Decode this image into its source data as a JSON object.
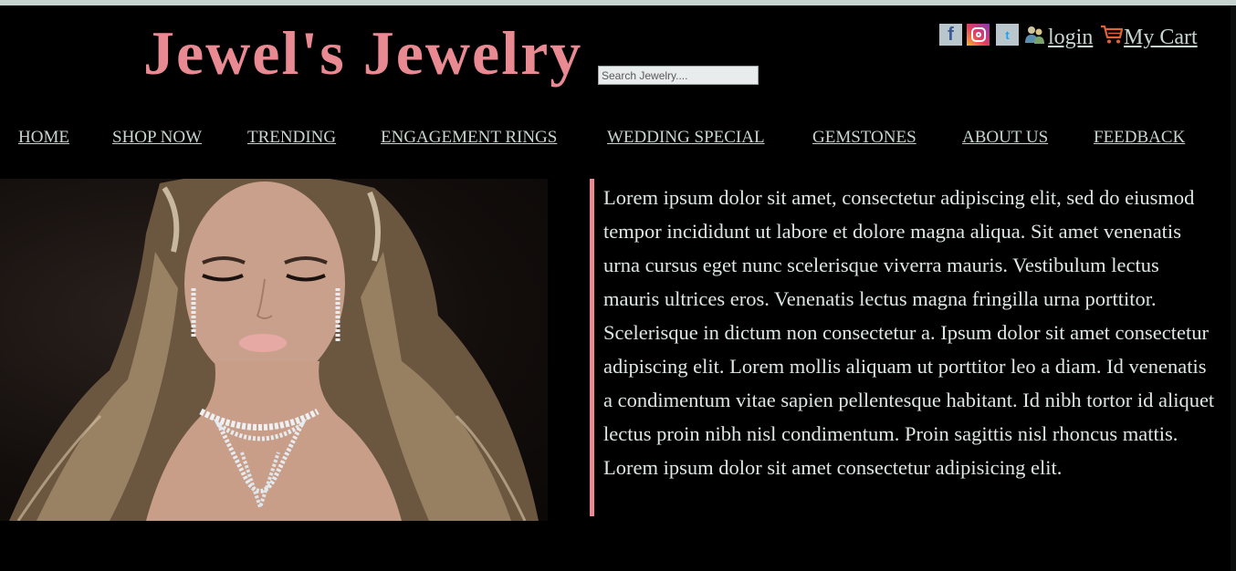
{
  "header": {
    "brand_title": "Jewel's Jewelry",
    "search_placeholder": "Search Jewelry....",
    "social": {
      "facebook_glyph": "f",
      "twitter_glyph": "t",
      "icons": [
        "facebook-icon",
        "instagram-icon",
        "twitter-icon"
      ]
    },
    "login_label": "login",
    "cart_label": "My Cart",
    "accent_color": "#e98a93",
    "link_color": "#c6d6cf"
  },
  "nav": {
    "items": [
      {
        "label": "HOME"
      },
      {
        "label": "SHOP NOW"
      },
      {
        "label": "TRENDING"
      },
      {
        "label": "ENGAGEMENT RINGS"
      },
      {
        "label": "WEDDING SPECIAL"
      },
      {
        "label": "GEMSTONES"
      },
      {
        "label": "ABOUT US"
      },
      {
        "label": "FEEDBACK"
      }
    ]
  },
  "main": {
    "hero_image": "woman-wearing-diamond-necklace-and-earrings",
    "body_text": "Lorem ipsum dolor sit amet, consectetur adipiscing elit, sed do eiusmod tempor incididunt ut labore et dolore magna aliqua. Sit amet venenatis urna cursus eget nunc scelerisque viverra mauris. Vestibulum lectus mauris ultrices eros. Venenatis lectus magna fringilla urna porttitor. Scelerisque in dictum non consectetur a. Ipsum dolor sit amet consectetur adipiscing elit. Lorem mollis aliquam ut porttitor leo a diam. Id venenatis a condimentum vitae sapien pellentesque habitant. Id nibh tortor id aliquet lectus proin nibh nisl condimentum. Proin sagittis nisl rhoncus mattis. Lorem ipsum dolor sit amet consectetur adipisicing elit."
  }
}
